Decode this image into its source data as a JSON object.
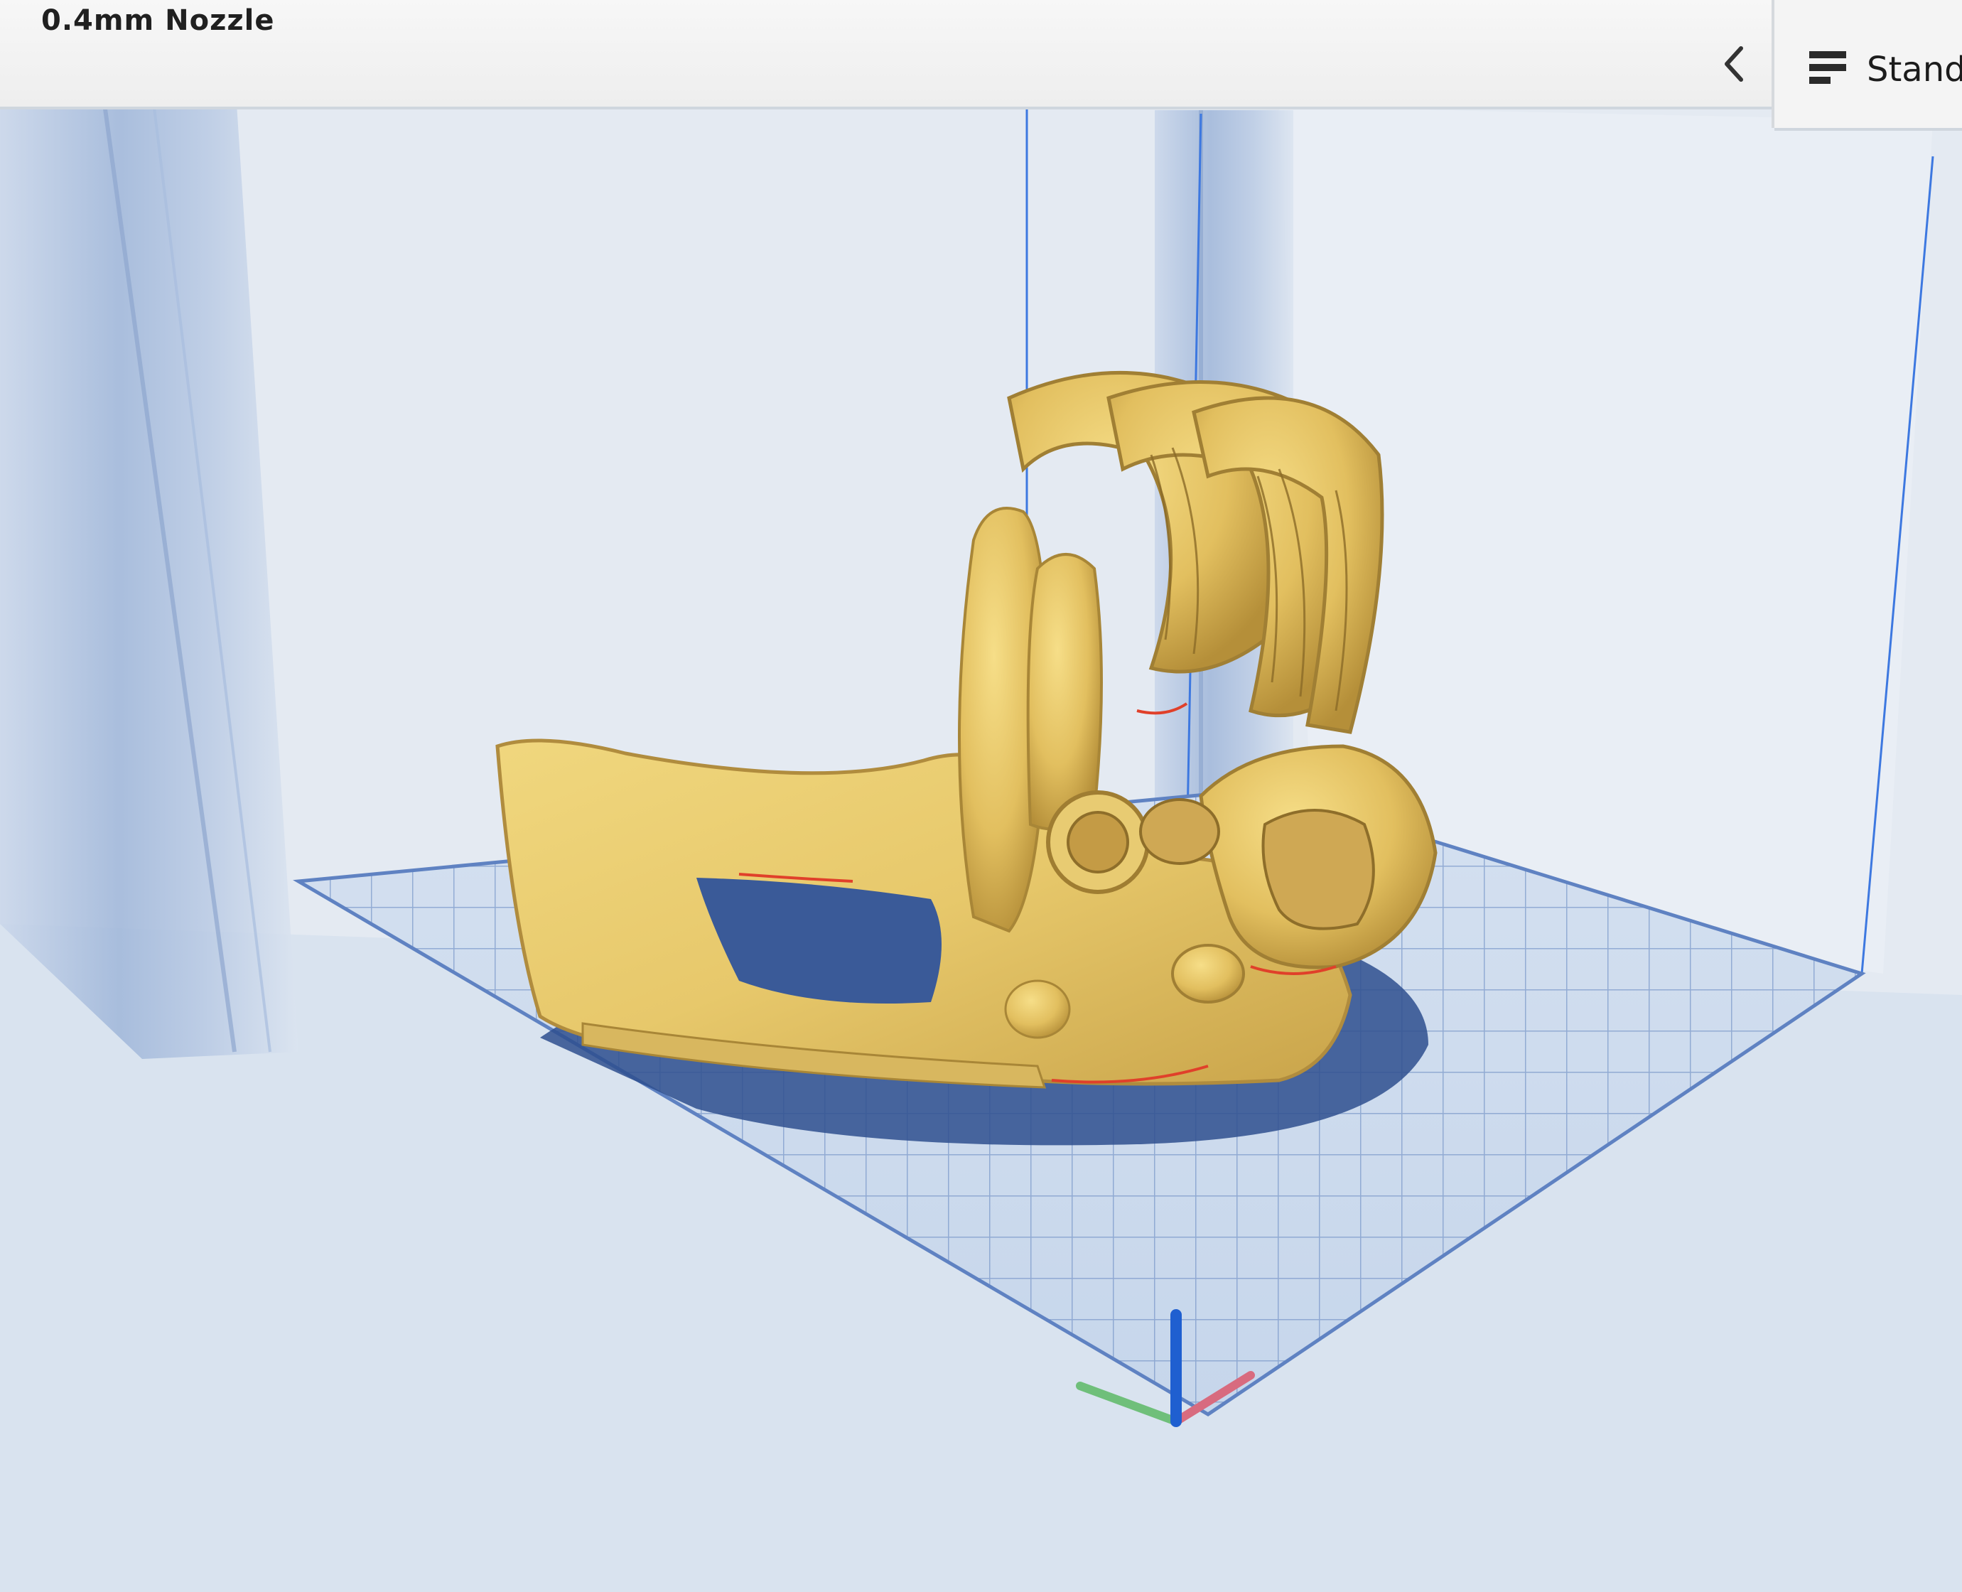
{
  "header": {
    "nozzle_label": "0.4mm Nozzle",
    "profile_label": "Stand",
    "collapse_icon": "chevron-left-icon",
    "profile_icon": "print-settings-icon"
  },
  "viewport": {
    "model_color": "#e6c56a",
    "build_plate_color": "#d0dced",
    "grid_color": "#6f8fc4",
    "axis_colors": {
      "x": "#d86b7f",
      "y": "#6fbf7a",
      "z": "#1f5fd0"
    }
  }
}
